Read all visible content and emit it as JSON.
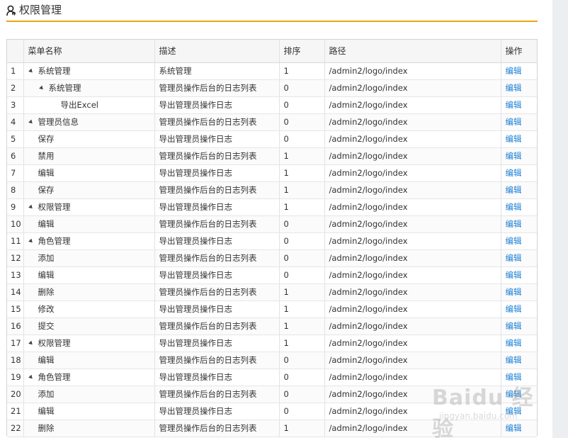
{
  "header": {
    "title": "权限管理"
  },
  "table": {
    "columns": [
      "菜单名称",
      "描述",
      "排序",
      "路径",
      "操作"
    ],
    "rows": [
      {
        "no": "1",
        "name": "系统管理",
        "level": 0,
        "expanded": true,
        "desc": "系统管理",
        "sort": "1",
        "path": "/admin2/logo/index",
        "action": "编辑"
      },
      {
        "no": "2",
        "name": "系统管理",
        "level": 1,
        "expanded": true,
        "desc": "管理员操作后台的日志列表",
        "sort": "0",
        "path": "/admin2/logo/index",
        "action": "编辑"
      },
      {
        "no": "3",
        "name": "导出Excel",
        "level": 2,
        "expanded": false,
        "desc": "导出管理员操作日志",
        "sort": "0",
        "path": "/admin2/logo/index",
        "action": "编辑"
      },
      {
        "no": "4",
        "name": "管理员信息",
        "level": 0,
        "expanded": true,
        "desc": "管理员操作后台的日志列表",
        "sort": "0",
        "path": "/admin2/logo/index",
        "action": "编辑"
      },
      {
        "no": "5",
        "name": "保存",
        "level": 1,
        "expanded": false,
        "desc": "导出管理员操作日志",
        "sort": "0",
        "path": "/admin2/logo/index",
        "action": "编辑"
      },
      {
        "no": "6",
        "name": "禁用",
        "level": 1,
        "expanded": false,
        "desc": "管理员操作后台的日志列表",
        "sort": "1",
        "path": "/admin2/logo/index",
        "action": "编辑"
      },
      {
        "no": "7",
        "name": "编辑",
        "level": 1,
        "expanded": false,
        "desc": "导出管理员操作日志",
        "sort": "1",
        "path": "/admin2/logo/index",
        "action": "编辑"
      },
      {
        "no": "8",
        "name": "保存",
        "level": 1,
        "expanded": false,
        "desc": "管理员操作后台的日志列表",
        "sort": "1",
        "path": "/admin2/logo/index",
        "action": "编辑"
      },
      {
        "no": "9",
        "name": "权限管理",
        "level": 0,
        "expanded": true,
        "desc": "导出管理员操作日志",
        "sort": "1",
        "path": "/admin2/logo/index",
        "action": "编辑"
      },
      {
        "no": "10",
        "name": "编辑",
        "level": 1,
        "expanded": false,
        "desc": "管理员操作后台的日志列表",
        "sort": "0",
        "path": "/admin2/logo/index",
        "action": "编辑"
      },
      {
        "no": "11",
        "name": "角色管理",
        "level": 0,
        "expanded": true,
        "desc": "导出管理员操作日志",
        "sort": "0",
        "path": "/admin2/logo/index",
        "action": "编辑"
      },
      {
        "no": "12",
        "name": "添加",
        "level": 1,
        "expanded": false,
        "desc": "管理员操作后台的日志列表",
        "sort": "0",
        "path": "/admin2/logo/index",
        "action": "编辑"
      },
      {
        "no": "13",
        "name": "编辑",
        "level": 1,
        "expanded": false,
        "desc": "导出管理员操作日志",
        "sort": "0",
        "path": "/admin2/logo/index",
        "action": "编辑"
      },
      {
        "no": "14",
        "name": "删除",
        "level": 1,
        "expanded": false,
        "desc": "管理员操作后台的日志列表",
        "sort": "1",
        "path": "/admin2/logo/index",
        "action": "编辑"
      },
      {
        "no": "15",
        "name": "修改",
        "level": 1,
        "expanded": false,
        "desc": "导出管理员操作日志",
        "sort": "1",
        "path": "/admin2/logo/index",
        "action": "编辑"
      },
      {
        "no": "16",
        "name": "提交",
        "level": 1,
        "expanded": false,
        "desc": "管理员操作后台的日志列表",
        "sort": "1",
        "path": "/admin2/logo/index",
        "action": "编辑"
      },
      {
        "no": "17",
        "name": "权限管理",
        "level": 0,
        "expanded": true,
        "desc": "导出管理员操作日志",
        "sort": "1",
        "path": "/admin2/logo/index",
        "action": "编辑"
      },
      {
        "no": "18",
        "name": "编辑",
        "level": 1,
        "expanded": false,
        "desc": "管理员操作后台的日志列表",
        "sort": "0",
        "path": "/admin2/logo/index",
        "action": "编辑"
      },
      {
        "no": "19",
        "name": "角色管理",
        "level": 0,
        "expanded": true,
        "desc": "导出管理员操作日志",
        "sort": "0",
        "path": "/admin2/logo/index",
        "action": "编辑"
      },
      {
        "no": "20",
        "name": "添加",
        "level": 1,
        "expanded": false,
        "desc": "管理员操作后台的日志列表",
        "sort": "0",
        "path": "/admin2/logo/index",
        "action": "编辑"
      },
      {
        "no": "21",
        "name": "编辑",
        "level": 1,
        "expanded": false,
        "desc": "导出管理员操作日志",
        "sort": "0",
        "path": "/admin2/logo/index",
        "action": "编辑"
      },
      {
        "no": "22",
        "name": "删除",
        "level": 1,
        "expanded": false,
        "desc": "管理员操作后台的日志列表",
        "sort": "1",
        "path": "/admin2/logo/index",
        "action": "编辑"
      }
    ]
  },
  "watermark": {
    "main": "Baidu 经验",
    "sub": "jingyan.baidu.com"
  },
  "colors": {
    "accent_line": "#e8a60e",
    "link": "#1a7fd4"
  }
}
